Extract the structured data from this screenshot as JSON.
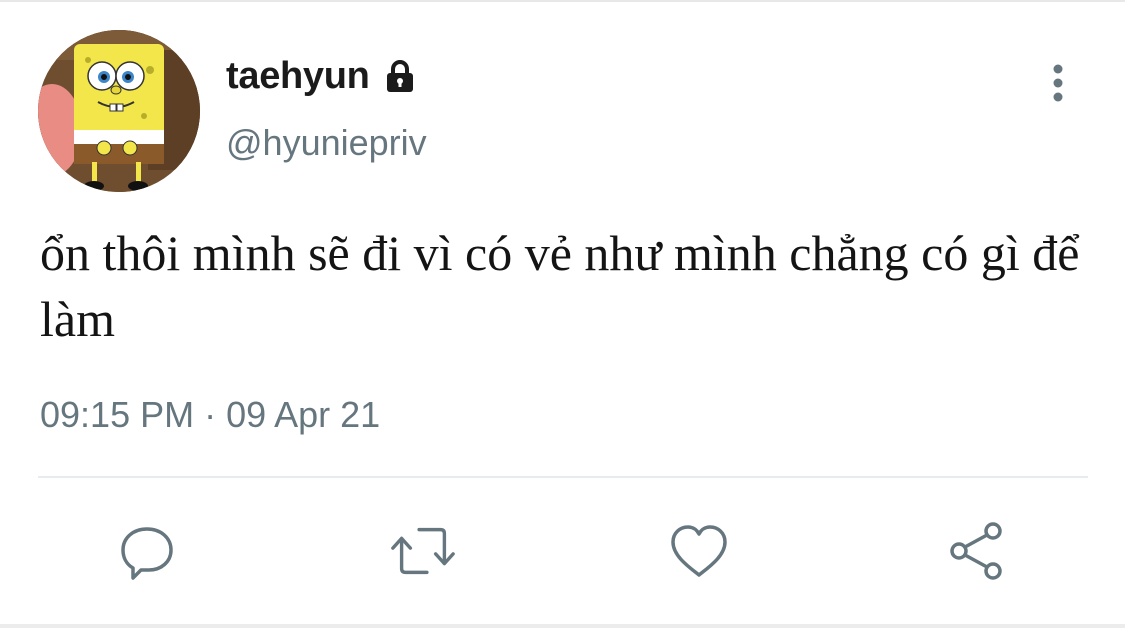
{
  "tweet": {
    "display_name": "taehyun",
    "handle": "@hyuniepriv",
    "text": "ổn thôi mình sẽ đi vì có vẻ như mình chẳng có gì để làm",
    "timestamp": "09:15 PM · 09 Apr 21",
    "protected": true,
    "avatar": "spongebob-avatar"
  },
  "icons": {
    "lock": "lock-icon",
    "more": "more-vertical-icon",
    "reply": "reply-icon",
    "retweet": "retweet-icon",
    "like": "heart-icon",
    "share": "share-icon"
  },
  "colors": {
    "text_primary": "#141414",
    "text_secondary": "#66767f",
    "icon_gray": "#66767f",
    "divider": "#e6ecf0"
  }
}
